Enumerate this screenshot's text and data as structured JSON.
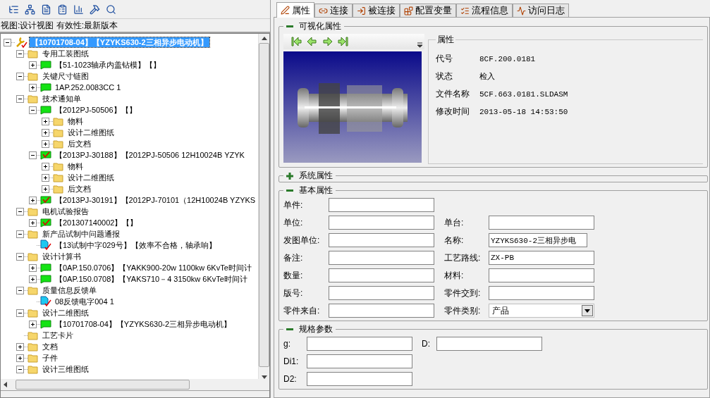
{
  "view_info": "视图:设计视图 有效性:最新版本",
  "tree": {
    "label": "【10701708-04】【YZYKS630-2三相异步电动机】",
    "kind": "tool",
    "expanded": true,
    "selected": true,
    "children": [
      {
        "label": "专用工装图纸",
        "kind": "folder",
        "expanded": true,
        "selected": false,
        "children": [
          {
            "label": "【51-1023轴承内盖钻模】【】",
            "kind": "document",
            "expanded": false,
            "selected": false
          }
        ]
      },
      {
        "label": "关键尺寸链图",
        "kind": "folder",
        "expanded": true,
        "selected": false,
        "children": [
          {
            "label": "1AP.252.0083CC 1",
            "kind": "document",
            "expanded": false,
            "selected": false
          }
        ]
      },
      {
        "label": "技术通知单",
        "kind": "folder",
        "expanded": true,
        "selected": false,
        "children": [
          {
            "label": "【2012PJ-50506】【】",
            "kind": "document",
            "expanded": true,
            "selected": false,
            "children": [
              {
                "label": "物料",
                "kind": "folder",
                "expanded": false,
                "selected": false
              },
              {
                "label": "设计二维图纸",
                "kind": "folder",
                "expanded": false,
                "selected": false
              },
              {
                "label": "后文档",
                "kind": "folder",
                "expanded": false,
                "selected": false
              }
            ]
          },
          {
            "label": "【2013PJ-30188】【2012PJ-50506 12H10024B YZYK",
            "kind": "checked-document",
            "expanded": true,
            "selected": false,
            "children": [
              {
                "label": "物料",
                "kind": "folder",
                "expanded": false,
                "selected": false
              },
              {
                "label": "设计二维图纸",
                "kind": "folder",
                "expanded": false,
                "selected": false
              },
              {
                "label": "后文档",
                "kind": "folder",
                "expanded": false,
                "selected": false
              }
            ]
          },
          {
            "label": "【2013PJ-30191】【2012PJ-70101（12H10024B YZYKS",
            "kind": "checked-document",
            "expanded": false,
            "selected": false
          }
        ]
      },
      {
        "label": "电机试验报告",
        "kind": "folder",
        "expanded": true,
        "selected": false,
        "children": [
          {
            "label": "【201307140002】【】",
            "kind": "checked-document",
            "expanded": false,
            "selected": false
          }
        ]
      },
      {
        "label": "新产品试制中问题通报",
        "kind": "folder",
        "expanded": true,
        "selected": false,
        "children": [
          {
            "label": "【13试制中字029号】【效率不合格，轴承响】",
            "kind": "report",
            "selected": false
          }
        ]
      },
      {
        "label": "设计计算书",
        "kind": "folder",
        "expanded": true,
        "selected": false,
        "children": [
          {
            "label": "【0AP.150.0706】【YAKK900-20w 1100kw 6KvTe时间计",
            "kind": "document",
            "expanded": false,
            "selected": false
          },
          {
            "label": "【0AP.150.0708】【YAKS710－4 3150kw 6KvTe时间计",
            "kind": "document",
            "expanded": false,
            "selected": false
          }
        ]
      },
      {
        "label": "质量信息反馈单",
        "kind": "folder",
        "expanded": true,
        "selected": false,
        "children": [
          {
            "label": "08反馈电字004 1",
            "kind": "report",
            "selected": false
          }
        ]
      },
      {
        "label": "设计二维图纸",
        "kind": "folder",
        "expanded": true,
        "selected": false,
        "children": [
          {
            "label": "【10701708-04】【YZYKS630-2三相异步电动机】",
            "kind": "document",
            "expanded": false,
            "selected": false
          }
        ]
      },
      {
        "label": "工艺卡片",
        "kind": "folder",
        "selected": false
      },
      {
        "label": "文档",
        "kind": "folder",
        "expanded": false,
        "selected": false
      },
      {
        "label": "子件",
        "kind": "folder",
        "expanded": false,
        "selected": false
      },
      {
        "label": "设计三维图纸",
        "kind": "folder",
        "expanded": true,
        "selected": false
      }
    ]
  },
  "tabs": [
    {
      "label": "属性",
      "selected": true
    },
    {
      "label": "连接",
      "selected": false
    },
    {
      "label": "被连接",
      "selected": false
    },
    {
      "label": "配置变量",
      "selected": false
    },
    {
      "label": "流程信息",
      "selected": false
    },
    {
      "label": "访问日志",
      "selected": false
    }
  ],
  "visual": {
    "title": "可视化属性",
    "expanded": true,
    "properties_title": "属性",
    "properties": [
      {
        "label": "代号",
        "value": "8CF.200.0181"
      },
      {
        "label": "状态",
        "value": "检入"
      },
      {
        "label": "文件名称",
        "value": "5CF.663.0181.SLDASM"
      },
      {
        "label": "修改时间",
        "value": "2013-05-18 14:53:50"
      }
    ]
  },
  "system": {
    "title": "系统属性",
    "expanded": false
  },
  "basic": {
    "title": "基本属性",
    "expanded": true,
    "rows": [
      {
        "left": {
          "label": "单件:",
          "kind": "text"
        }
      },
      {
        "left": {
          "label": "单位:",
          "kind": "text"
        },
        "right": {
          "label": "单台:",
          "kind": "text"
        }
      },
      {
        "left": {
          "label": "发图单位:",
          "kind": "text"
        },
        "right": {
          "label": "名称:",
          "value": "YZYKS630-2三相异步电",
          "kind": "short"
        }
      },
      {
        "left": {
          "label": "备注:",
          "kind": "text"
        },
        "right": {
          "label": "工艺路线:",
          "value": "ZX-PB",
          "kind": "text"
        }
      },
      {
        "left": {
          "label": "数量:",
          "kind": "text"
        },
        "right": {
          "label": "材料:",
          "kind": "text"
        }
      },
      {
        "left": {
          "label": "版号:",
          "kind": "text"
        },
        "right": {
          "label": "零件交到:",
          "kind": "text"
        }
      },
      {
        "left": {
          "label": "零件来自:",
          "kind": "text"
        },
        "right": {
          "label": "零件类别:",
          "value": "产品",
          "kind": "select"
        }
      }
    ]
  },
  "spec": {
    "title": "规格参数",
    "expanded": true,
    "rows": [
      {
        "left": {
          "label": "g:",
          "kind": "text"
        },
        "right": {
          "label": "D:",
          "kind": "text"
        }
      },
      {
        "left": {
          "label": "Di1:",
          "kind": "text"
        }
      },
      {
        "left": {
          "label": "D2:",
          "kind": "text"
        }
      }
    ]
  }
}
